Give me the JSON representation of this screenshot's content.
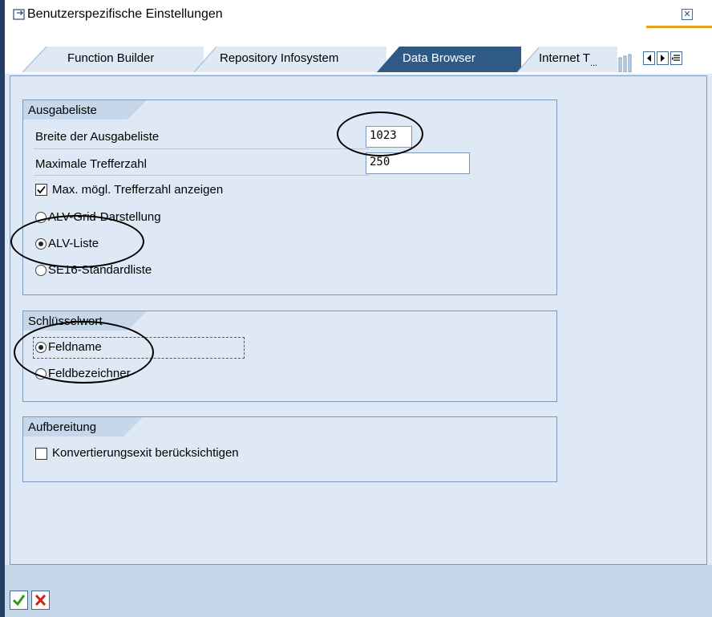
{
  "window": {
    "title": "Benutzerspezifische Einstellungen",
    "title_icon": "window-redirect-icon",
    "close_icon": "close-icon"
  },
  "tabs": [
    {
      "label": "Function Builder",
      "active": false
    },
    {
      "label": "Repository Infosystem",
      "active": false
    },
    {
      "label": "Data Browser",
      "active": true
    },
    {
      "label": "Internet T",
      "active": false,
      "truncated_marker": "..."
    }
  ],
  "tab_nav": {
    "prev_icon": "scroll-left-icon",
    "next_icon": "scroll-right-icon",
    "list_icon": "tab-list-icon"
  },
  "ausgabeliste": {
    "title": "Ausgabeliste",
    "breite_label": "Breite der Ausgabeliste",
    "breite_value": "1023",
    "max_label": "Maximale Trefferzahl",
    "max_value": "250",
    "show_max_label": "Max. mögl. Trefferzahl anzeigen",
    "show_max_checked": true,
    "radio_options": [
      {
        "label": "ALV-Grid-Darstellung",
        "selected": false
      },
      {
        "label": "ALV-Liste",
        "selected": true
      },
      {
        "label": "SE16-Standardliste",
        "selected": false
      }
    ]
  },
  "schluesselwort": {
    "title": "Schlüsselwort",
    "radio_options": [
      {
        "label": "Feldname",
        "selected": true
      },
      {
        "label": "Feldbezeichner",
        "selected": false
      }
    ]
  },
  "aufbereitung": {
    "title": "Aufbereitung",
    "konvert_label": "Konvertierungsexit berücksichtigen",
    "konvert_checked": false
  },
  "footer": {
    "confirm_icon": "checkmark-icon",
    "cancel_icon": "cancel-x-icon"
  },
  "colors": {
    "active_tab": "#2f5a86",
    "background": "#dfe9f5",
    "accent": "#e8a020"
  }
}
